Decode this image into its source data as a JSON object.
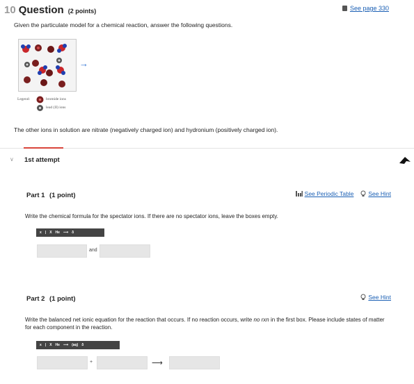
{
  "question": {
    "number": "10",
    "word": "Question",
    "points": "(2 points)",
    "see_page": "See page 330",
    "prompt": "Given the particulate model for a chemical reaction, answer the following questions.",
    "other_ions": "The other ions in solution are nitrate (negatively charged ion) and hydronium (positively charged ion)."
  },
  "legend": {
    "title": "Legend:",
    "items": [
      {
        "label": "bromide ions",
        "icon": "bromide-ion-icon",
        "color": "#7a1f1f"
      },
      {
        "label": "lead (II) ions",
        "icon": "lead-ion-icon",
        "color": "#555555"
      }
    ]
  },
  "attempt": {
    "title": "1st attempt"
  },
  "part1": {
    "title": "Part 1",
    "points": "(1 point)",
    "periodic_table_link": "See Periodic Table",
    "hint_link": "See Hint",
    "instructions": "Write the chemical formula for the spectator ions. If there are no spectator ions, leave the boxes empty.",
    "toolbar": [
      "x",
      "|",
      "X",
      "He",
      "⟶",
      "δ"
    ],
    "connector": "and"
  },
  "part2": {
    "title": "Part 2",
    "points": "(1 point)",
    "hint_link": "See Hint",
    "instructions_pre": "Write the balanced net ionic equation for the reaction that occurs. If no reaction occurs, write ",
    "instructions_em": "no rxn",
    "instructions_post": " in the first box. Please include states of matter for each component in the reaction.",
    "toolbar": [
      "x",
      "|",
      "X",
      "He",
      "⟶",
      "(aq)",
      "δ"
    ],
    "plus": "+",
    "arrow": "⟶"
  },
  "colors": {
    "accent_red": "#d9453a",
    "link_blue": "#1a5fb4",
    "arrow_blue": "#2a6fd1",
    "box_grey": "#e6e6e6",
    "toolbar_dark": "#444444"
  }
}
